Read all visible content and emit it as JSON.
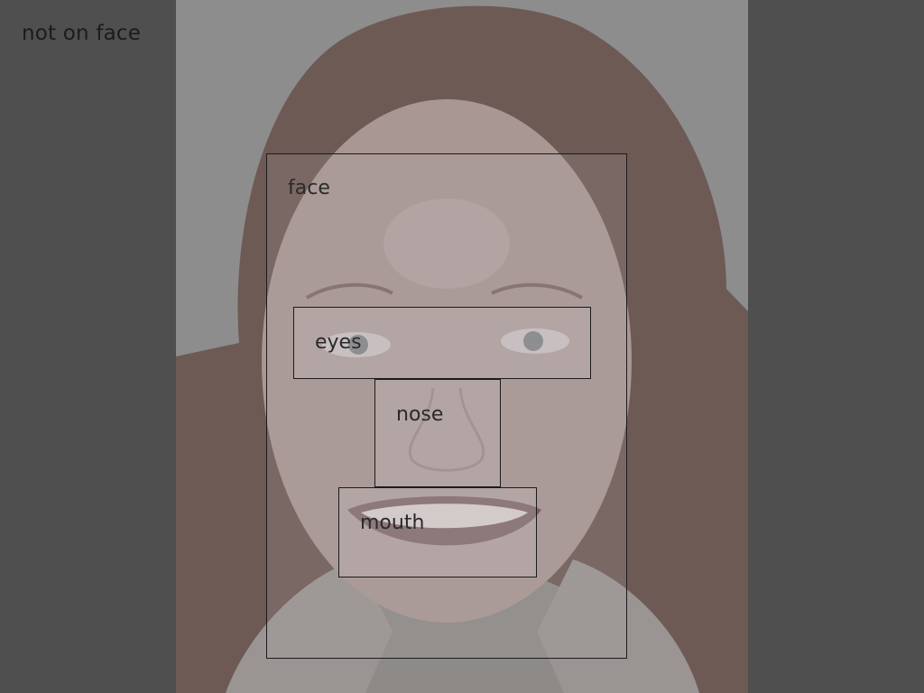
{
  "labels": {
    "not_on_face": "not on face",
    "face": "face",
    "eyes": "eyes",
    "nose": "nose",
    "mouth": "mouth"
  },
  "colors": {
    "outer_background": "#4f4f4f",
    "photo_background": "#8d8d8d",
    "hair": "#6e5a55",
    "skin": "#a99794",
    "box_border": "#1b1b1b",
    "label_text": "#2a2a2a"
  },
  "image": {
    "subject": "portrait-photo",
    "icon": "portrait-photo-icon"
  }
}
